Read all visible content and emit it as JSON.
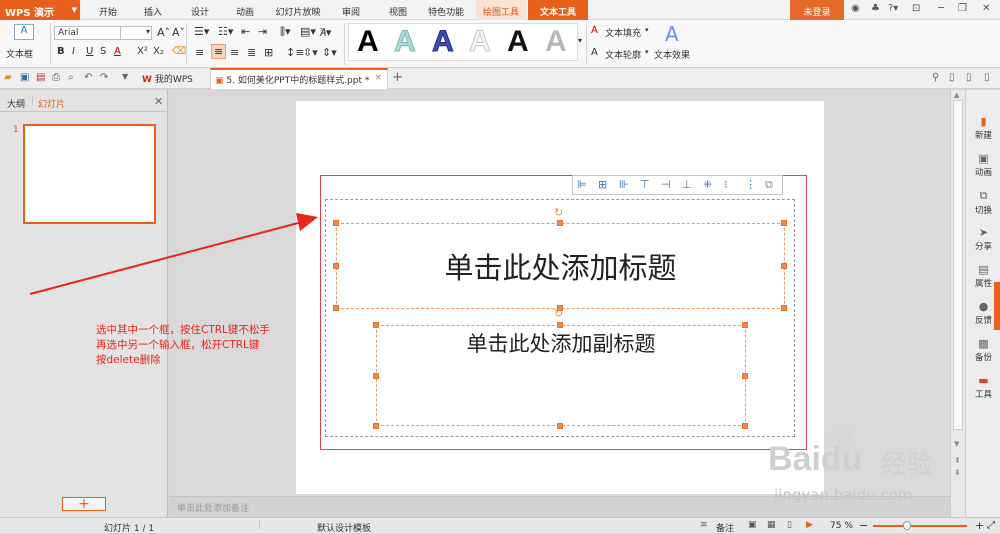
{
  "app": {
    "name": "WPS 演示"
  },
  "menu": {
    "items": [
      "开始",
      "插入",
      "设计",
      "动画",
      "幻灯片放映",
      "审阅",
      "视图",
      "特色功能"
    ],
    "context_tabs": [
      "绘图工具",
      "文本工具"
    ],
    "login_label": "未登录"
  },
  "ribbon": {
    "textbox_label": "文本框",
    "font_name": "Arial",
    "text_fill_label": "文本填充",
    "text_outline_label": "文本轮廓",
    "text_effect_label": "文本效果"
  },
  "tabs": {
    "my_wps": "我的WPS",
    "doc": "5. 如何美化PPT中的标题样式.ppt *"
  },
  "left_panel": {
    "tab_outline": "大纲",
    "tab_slides": "幻灯片",
    "slide_number": "1"
  },
  "slide": {
    "title_placeholder": "单击此处添加标题",
    "subtitle_placeholder": "单击此处添加副标题"
  },
  "notes_placeholder": "单击此处添加备注",
  "annotation": {
    "lines": [
      "选中其中一个框，按住CTRL键不松手",
      "再选中另一个输入框，松开CTRL键",
      "按delete删除"
    ],
    "color": "#e8261c"
  },
  "right_panel": {
    "items": [
      "新建",
      "动画",
      "切换",
      "分享",
      "属性",
      "反馈",
      "备份",
      "工具"
    ]
  },
  "status": {
    "slide_counter": "幻灯片 1 / 1",
    "template": "默认设计模板",
    "notes_btn": "备注",
    "zoom": "75 %"
  },
  "watermark": {
    "brand": "Baidu",
    "brand_cn": "经验",
    "url": "jingyan.baidu.com"
  },
  "colors": {
    "accent": "#e8601c"
  }
}
